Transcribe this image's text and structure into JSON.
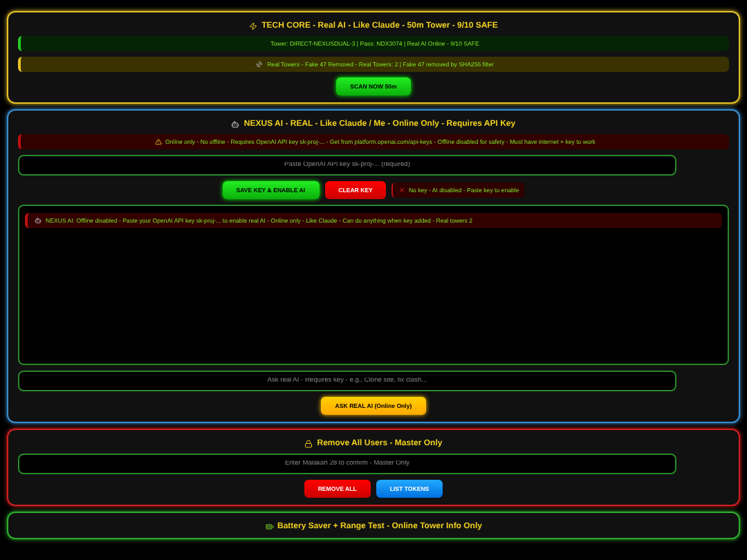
{
  "sections": [
    {
      "kind": "tower",
      "title": "TECH CORE - Real AI - Like Claude - 50m Tower - 9/10 SAFE",
      "banners": [
        {
          "text": "Tower: DIRECT-NEXUSDUAL-3 | Pass: NDX3074 | Real AI Online - 9/10 SAFE"
        },
        {
          "text": "Real Towers - Fake 47 Removed - Real Towers: 2 | Fake 47 removed by SHA256 filter"
        }
      ],
      "buttons": [
        {
          "label": "SCAN NOW 50m"
        }
      ]
    },
    {
      "kind": "ai",
      "title": "NEXUS AI - REAL - Like Claude / Me - Online Only - Requires API Key",
      "banners": [
        {
          "text": "Online only - No offline - Requires OpenAI API key sk-proj-... - Get from platform.openai.com/api-keys - Offline disabled for safety - Must have internet + key to work"
        }
      ],
      "field": {
        "placeholder": "Paste OpenAI API key sk-proj-... (required)"
      },
      "buttons": [
        {
          "label": "SAVE KEY & ENABLE AI"
        },
        {
          "label": "CLEAR KEY"
        }
      ],
      "status": {
        "text": "No key - AI disabled - Paste key to enable"
      },
      "chat": [
        {
          "text": "NEXUS AI: Offline disabled - Paste your OpenAI API key sk-proj-... to enable real AI - Online only - Like Claude - Can do anything when key added - Real towers 2"
        }
      ],
      "ask": {
        "placeholder": "Ask real AI - Requires key - e.g., Clone site, fix clash..."
      },
      "ask_button": {
        "label": "ASK REAL AI (Online Only)"
      }
    },
    {
      "kind": "master",
      "title": "Remove All Users - Master Only",
      "field": {
        "placeholder": "Enter Malakah 28 to confirm - Master Only"
      },
      "buttons": [
        {
          "label": "REMOVE ALL"
        },
        {
          "label": "LIST TOKENS"
        }
      ]
    },
    {
      "kind": "battery",
      "title": "Battery Saver + Range Test - Online Tower Info Only"
    }
  ]
}
